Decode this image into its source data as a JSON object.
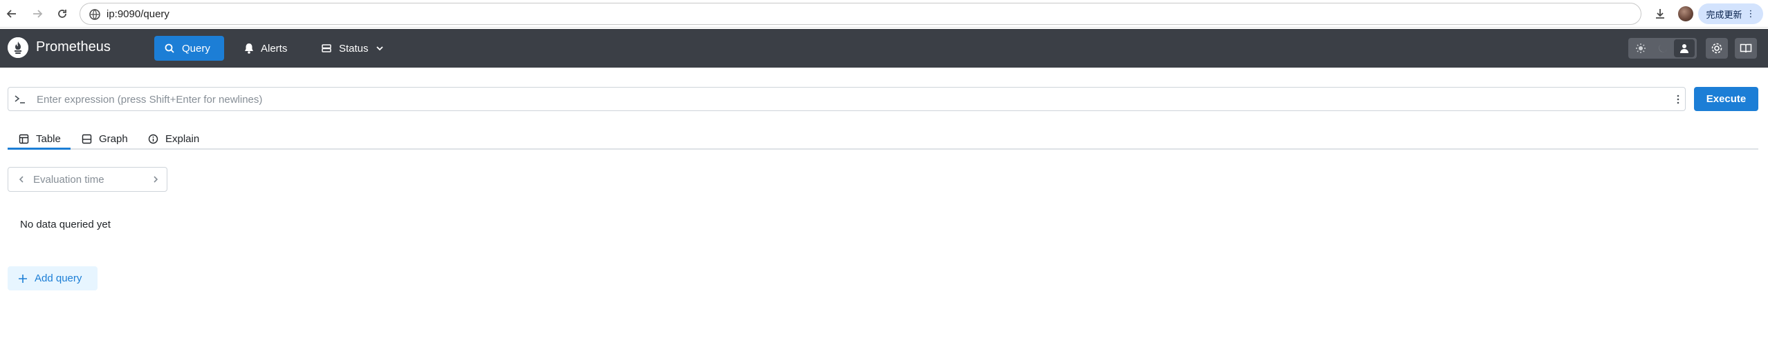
{
  "browser": {
    "url": "ip:9090/query",
    "update_button": "完成更新"
  },
  "navbar": {
    "brand": "Prometheus",
    "items": [
      {
        "label": "Query",
        "icon": "search-icon",
        "active": true
      },
      {
        "label": "Alerts",
        "icon": "bell-icon",
        "active": false
      },
      {
        "label": "Status",
        "icon": "server-icon",
        "active": false
      }
    ],
    "theme_options": [
      "light-theme-icon",
      "dark-theme-icon",
      "auto-theme-icon"
    ],
    "selected_theme": "auto"
  },
  "query": {
    "placeholder": "Enter expression (press Shift+Enter for newlines)",
    "value": "",
    "execute_label": "Execute"
  },
  "tabs": [
    {
      "label": "Table",
      "active": true
    },
    {
      "label": "Graph",
      "active": false
    },
    {
      "label": "Explain",
      "active": false
    }
  ],
  "evaluation": {
    "placeholder": "Evaluation time"
  },
  "result": {
    "message": "No data queried yet"
  },
  "add_query_label": "Add query",
  "colors": {
    "accent": "#1c7ed6",
    "navbar_bg": "#3b3f46",
    "accent_light": "#e7f5ff"
  }
}
